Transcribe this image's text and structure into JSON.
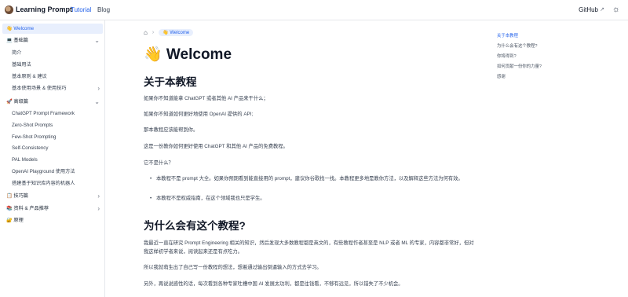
{
  "topbar": {
    "brand": "Learning Prompt",
    "nav": [
      "Tutorial",
      "Blog"
    ],
    "github": "GitHub",
    "ext_glyph": "↗",
    "theme_glyph": "☼"
  },
  "sidebar": {
    "items": [
      {
        "label": "👋 Welcome",
        "active": true
      },
      {
        "label": "💻 基础篇",
        "chevron": "⌄"
      },
      {
        "label": "简介",
        "sub": true
      },
      {
        "label": "基础用法",
        "sub": true
      },
      {
        "label": "基本原则 & 建议",
        "sub": true
      },
      {
        "label": "基本使用场景 & 使用技巧",
        "sub": true,
        "chevron": "›"
      },
      {
        "label": "🚀 高级篇",
        "chevron": "⌄"
      },
      {
        "label": "ChatGPT Prompt Framework",
        "sub": true
      },
      {
        "label": "Zero-Shot Prompts",
        "sub": true
      },
      {
        "label": "Few-Shot Prompting",
        "sub": true
      },
      {
        "label": "Self-Consistency",
        "sub": true
      },
      {
        "label": "PAL Models",
        "sub": true
      },
      {
        "label": "OpenAI Playground 使用方法",
        "sub": true
      },
      {
        "label": "搭建基于知识库内容的机器人",
        "sub": true
      },
      {
        "label": "📋 技巧篇",
        "chevron": "›"
      },
      {
        "label": "📚 资料 & 产品推荐",
        "chevron": "›"
      },
      {
        "label": "🔐 原理"
      }
    ]
  },
  "breadcrumb": {
    "home_glyph": "⌂",
    "sep": "›",
    "current": "👋 Welcome"
  },
  "content": {
    "title": "👋 Welcome",
    "h2_1": "关于本教程",
    "p1": "如果你不知道能拿 ChatGPT 或者其他 AI 产品来干什么；",
    "p2": "如果你不知道如何更好地使用 OpenAI 提供的 API;",
    "p3": "那本教程应该能帮到你。",
    "p4": "这是一份教你如何更好使用 ChatGPT 和其他 AI 产品的免费教程。",
    "p5": "它不是什么？",
    "bullets": [
      "本教程不是 prompt 大全。如果你预期看到能直接用的 prompt，建议你谷歌找一找。本教程更多地是教你方法，以及解释这些方法为何有效。",
      "本教程不是权威指南，在这个领域我也只是学生。"
    ],
    "h2_2": "为什么会有这个教程?",
    "p6": "我最近一直在研究 Prompt Engineering 相关的知识，然后发现大多数教程都是英文的，有些教程作者甚至是 NLP 或者 ML 的专家，内容都非常好，但对我这样初学者来说，阅读起来还是有点吃力。",
    "p7": "所以我就萌生出了自己写一份教程的想法，想着通过输出倒逼输入的方式去学习。",
    "p8": "另外，再说说感性的话，每次看到各种专家吐槽中国 AI 发展太功利，都是往钱看，不够有远见，所以错失了不少机会。"
  },
  "toc": {
    "items": [
      "关于本教程",
      "为什么会有这个教程?",
      "你将得到?",
      "如何贡献一份你的力量?",
      "感谢"
    ]
  }
}
